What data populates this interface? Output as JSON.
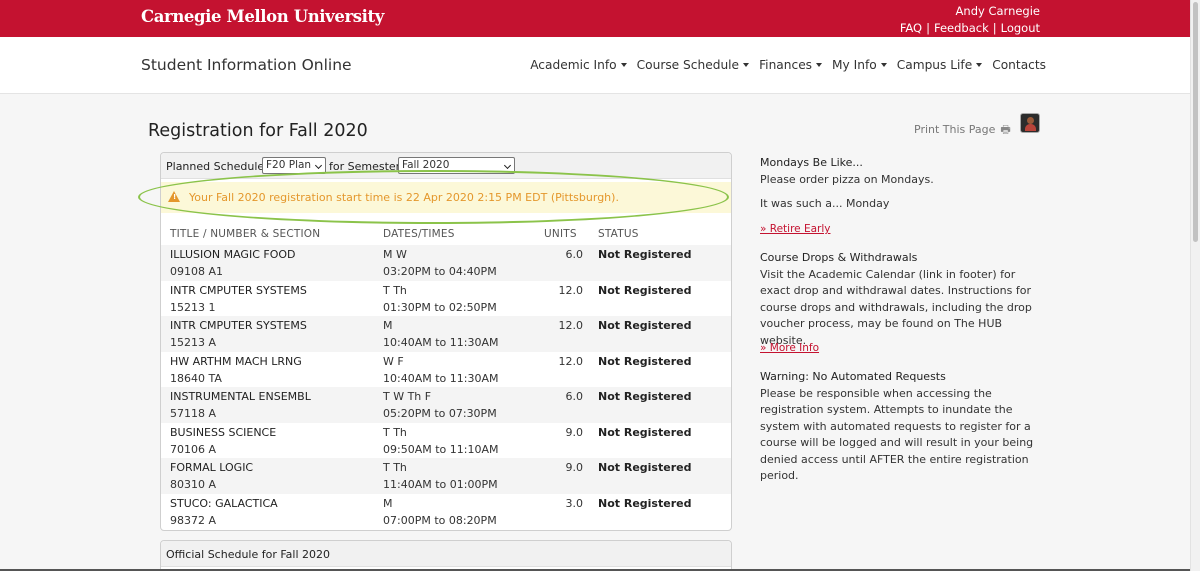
{
  "header": {
    "brand": "Carnegie Mellon University",
    "user_name": "Andy Carnegie",
    "links": [
      "FAQ",
      "Feedback",
      "Logout"
    ]
  },
  "nav": {
    "site_title": "Student Information Online",
    "menu": [
      "Academic Info",
      "Course Schedule",
      "Finances",
      "My Info",
      "Campus Life",
      "Contacts"
    ]
  },
  "page": {
    "title": "Registration for Fall 2020",
    "print_label": "Print This Page"
  },
  "planned": {
    "label": "Planned Schedule",
    "plan_value": "F20 Plan",
    "semester_label": "for Semester",
    "semester_value": "Fall 2020",
    "alert": "Your Fall 2020 registration start time is 22 Apr 2020 2:15 PM EDT (Pittsburgh).",
    "columns": [
      "TITLE / NUMBER & SECTION",
      "DATES/TIMES",
      "UNITS",
      "STATUS"
    ],
    "rows": [
      {
        "title": "ILLUSION MAGIC FOOD",
        "number": "09108 A1",
        "days": "M W",
        "time": "03:20PM to 04:40PM",
        "units": "6.0",
        "status": "Not Registered"
      },
      {
        "title": "INTR CMPUTER SYSTEMS",
        "number": "15213 1",
        "days": "T Th",
        "time": "01:30PM to 02:50PM",
        "units": "12.0",
        "status": "Not Registered"
      },
      {
        "title": "INTR CMPUTER SYSTEMS",
        "number": "15213 A",
        "days": "M",
        "time": "10:40AM to 11:30AM",
        "units": "12.0",
        "status": "Not Registered"
      },
      {
        "title": "HW ARTHM MACH LRNG",
        "number": "18640 TA",
        "days": "W F",
        "time": "10:40AM to 11:30AM",
        "units": "12.0",
        "status": "Not Registered"
      },
      {
        "title": "INSTRUMENTAL ENSEMBL",
        "number": "57118 A",
        "days": "T W Th F",
        "time": "05:20PM to 07:30PM",
        "units": "6.0",
        "status": "Not Registered"
      },
      {
        "title": "BUSINESS SCIENCE",
        "number": "70106 A",
        "days": "T Th",
        "time": "09:50AM to 11:10AM",
        "units": "9.0",
        "status": "Not Registered"
      },
      {
        "title": "FORMAL LOGIC",
        "number": "80310 A",
        "days": "T Th",
        "time": "11:40AM to 01:00PM",
        "units": "9.0",
        "status": "Not Registered"
      },
      {
        "title": "STUCO: GALACTICA",
        "number": "98372 A",
        "days": "M",
        "time": "07:00PM to 08:20PM",
        "units": "3.0",
        "status": "Not Registered"
      }
    ]
  },
  "official": {
    "label": "Official Schedule for Fall 2020"
  },
  "sidebar": {
    "block1_title": "Mondays Be Like...",
    "block1_text": "Please order pizza on Mondays.",
    "block1_text2": "It was such a... Monday",
    "block1_link": "» Retire Early",
    "block2_title": "Course Drops & Withdrawals",
    "block2_text": "Visit the Academic Calendar (link in footer) for exact drop and withdrawal dates. Instructions for course drops and withdrawals, including the drop voucher process, may be found on The HUB website.",
    "block2_link": "» More Info",
    "block3_title": "Warning: No Automated Requests",
    "block3_text": "Please be responsible when accessing the registration system. Attempts to inundate the system with automated requests to register for a course will be logged and will result in your being denied access until AFTER the entire registration period."
  }
}
